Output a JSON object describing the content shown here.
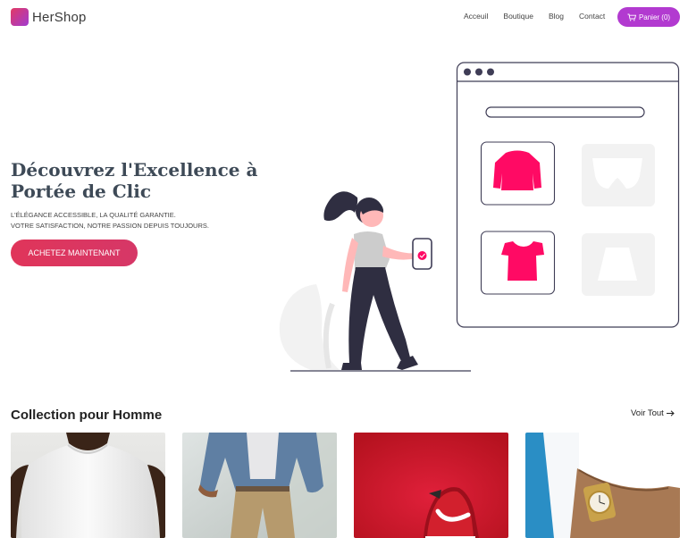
{
  "brand": {
    "name": "HerShop"
  },
  "nav": {
    "items": [
      "Acceuil",
      "Boutique",
      "Blog",
      "Contact"
    ],
    "cart_label": "Panier (0)"
  },
  "hero": {
    "title": "Découvrez l'Excellence à Portée de Clic",
    "subtitle_line1": "L'ÉLÉGANCE ACCESSIBLE, LA QUALITÉ GARANTIE.",
    "subtitle_line2": "VOTRE SATISFACTION, NOTRE PASSION DEPUIS TOUJOURS.",
    "cta_label": "ACHETEZ MAINTENANT"
  },
  "collection": {
    "title": "Collection pour Homme",
    "see_all": "Voir Tout",
    "products": [
      {
        "image": "white-tshirt-photo"
      },
      {
        "image": "denim-jacket-khaki-pants-photo"
      },
      {
        "image": "red-sneaker-photo"
      },
      {
        "image": "gold-wristwatch-photo"
      }
    ]
  },
  "colors": {
    "accent_purple": "#b23ad0",
    "accent_pink": "#e0355a",
    "illustration_pink": "#ff0a64"
  }
}
